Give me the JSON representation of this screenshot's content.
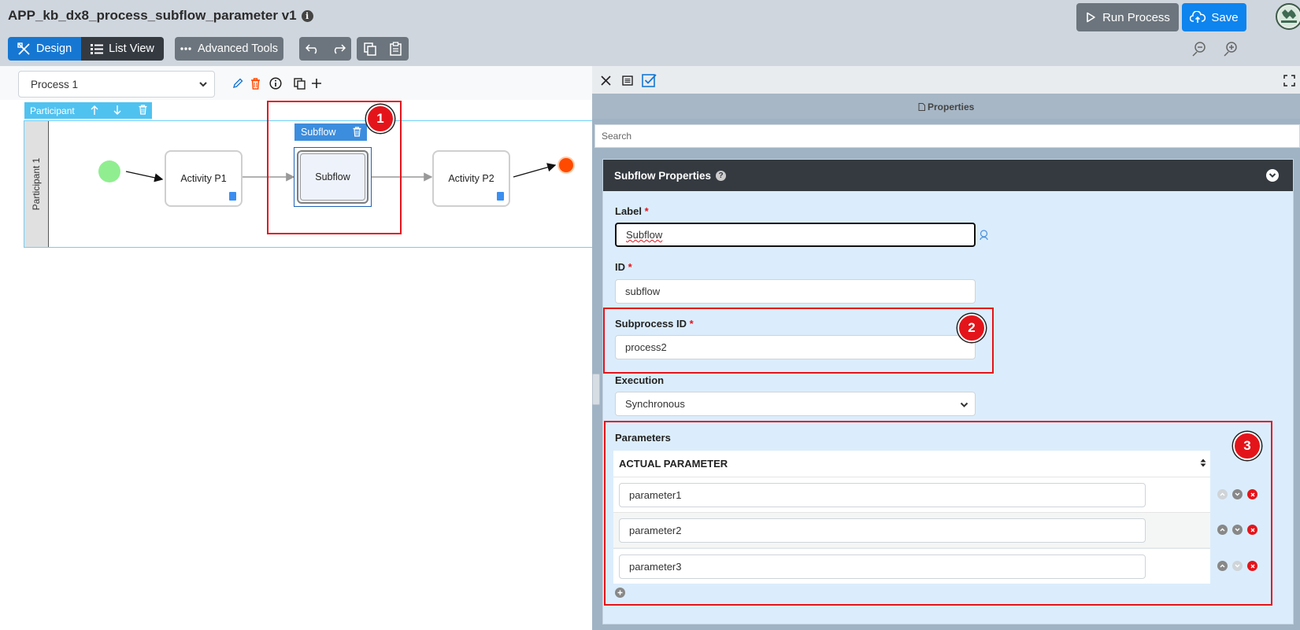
{
  "app": {
    "title": "APP_kb_dx8_process_subflow_parameter v1"
  },
  "header": {
    "run_label": "Run Process",
    "save_label": "Save",
    "design_label": "Design",
    "listview_label": "List View",
    "advanced_label": "Advanced Tools"
  },
  "canvas": {
    "process_select": "Process 1",
    "participant_tab": "Participant",
    "lane_label": "Participant 1",
    "nodes": {
      "activity1": "Activity P1",
      "subflow": "Subflow",
      "activity2": "Activity P2"
    },
    "subflow_tab": "Subflow"
  },
  "annotations": [
    "1",
    "2",
    "3"
  ],
  "panel": {
    "header_title": "Properties",
    "search_placeholder": "Search",
    "section_title": "Subflow Properties",
    "label_label": "Label",
    "label_value": "Subflow",
    "id_label": "ID",
    "id_value": "subflow",
    "subprocess_label": "Subprocess ID",
    "subprocess_value": "process2",
    "execution_label": "Execution",
    "execution_value": "Synchronous",
    "parameters_label": "Parameters",
    "column_header": "ACTUAL PARAMETER",
    "required_mark": "*",
    "params": [
      "parameter1",
      "parameter2",
      "parameter3"
    ]
  },
  "colors": {
    "accent": "#1677d2",
    "save": "#0d84ee",
    "annotation": "#e4141b",
    "start_event": "#90ee90",
    "end_event": "#ff4a00"
  },
  "icons": [
    "info-icon",
    "play-icon",
    "cloud-upload-icon",
    "design-icon",
    "list-icon",
    "dots-icon",
    "undo-icon",
    "redo-icon",
    "copy-icon",
    "paste-icon",
    "zoom-out-icon",
    "zoom-in-icon",
    "pencil-icon",
    "trash-icon",
    "duplicate-icon",
    "plus-icon",
    "close-icon",
    "form-icon",
    "checkbox-icon",
    "expand-icon"
  ]
}
